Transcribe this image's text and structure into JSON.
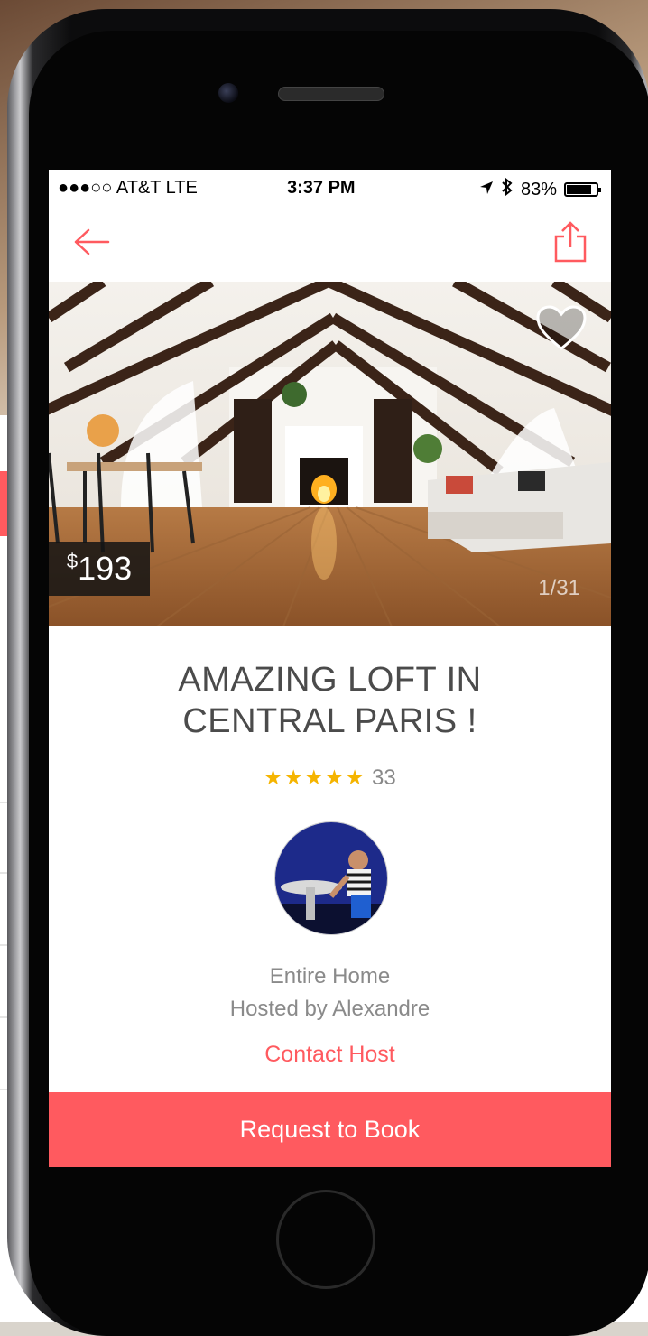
{
  "status_bar": {
    "carrier": "●●●○○ AT&T  LTE",
    "time": "3:37 PM",
    "battery_text": "83%",
    "battery_level": 0.83
  },
  "listing": {
    "price_currency": "$",
    "price_amount": "193",
    "photo_counter": "1/31",
    "title_line1": "AMAZING LOFT IN",
    "title_line2": "CENTRAL PARIS !",
    "stars": "★★★★★",
    "rating_value": 5,
    "review_count": "33",
    "room_type": "Entire Home",
    "host_line": "Hosted by Alexandre",
    "contact_label": "Contact Host",
    "book_label": "Request to Book"
  },
  "colors": {
    "accent": "#ff5a5f",
    "star": "#f5b400",
    "text_dark": "#4b4b4b",
    "text_muted": "#8a8a8a"
  },
  "icons": {
    "back": "arrow-left-icon",
    "share": "share-icon",
    "favorite": "heart-icon"
  }
}
